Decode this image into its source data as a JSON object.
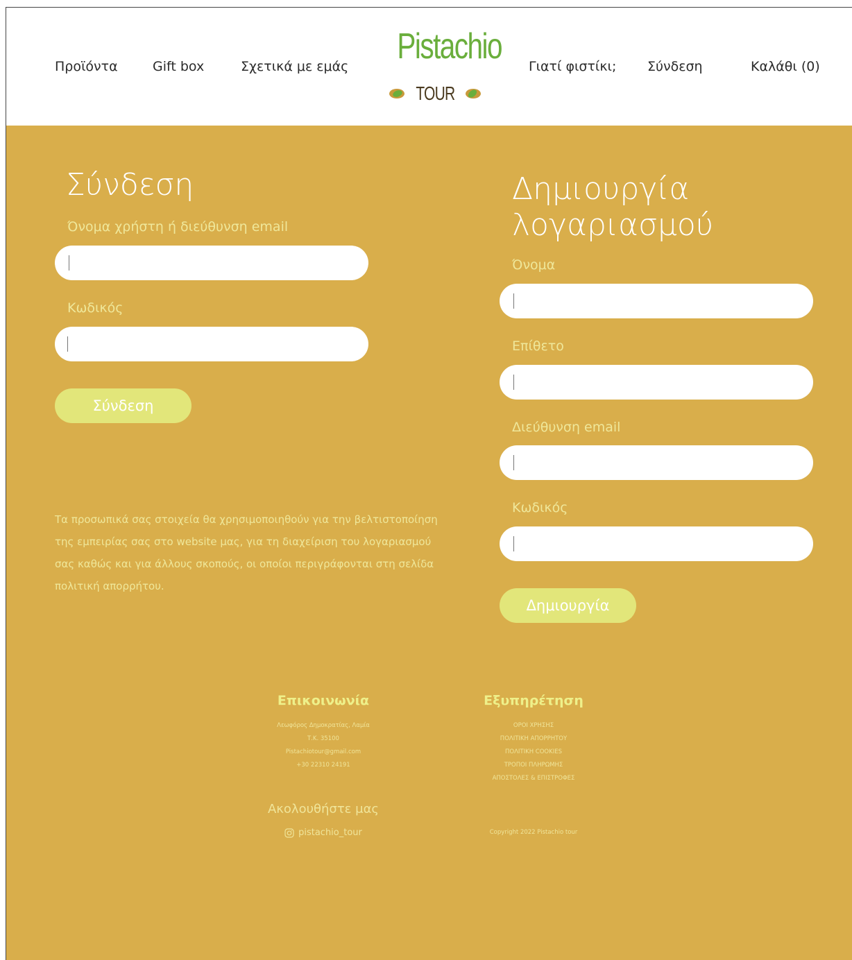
{
  "nav": {
    "left": [
      "Προϊόντα",
      "Gift box",
      "Σχετικά με εμάς"
    ],
    "right": [
      "Γιατί φιστίκι;",
      "Σύνδεση",
      "Καλάθι (0)"
    ]
  },
  "logo": {
    "word": "Pistachio",
    "sub": "TOUR",
    "colors": {
      "green": "#6aae3c",
      "brown": "#4a3a1f",
      "tan": "#c99a3b"
    }
  },
  "login": {
    "title": "Σύνδεση",
    "username_label": "Όνομα χρήστη ή διεύθυνση email",
    "password_label": "Κωδικός",
    "submit": "Σύνδεση"
  },
  "privacy": "Τα προσωπικά σας στοιχεία θα χρησιμοποιηθούν για την βελτιστοποίηση της εμπειρίας σας στο website μας, για τη διαχείριση του λογαριασμού σας καθώς και για άλλους σκοπούς, οι οποίοι περιγράφονται στη σελίδα πολιτική απορρήτου.",
  "register": {
    "title_line1": "Δημιουργία",
    "title_line2": "λογαριασμού",
    "first_name_label": "Όνομα",
    "last_name_label": "Επίθετο",
    "email_label": "Διεύθυνση email",
    "password_label": "Κωδικός",
    "submit": "Δημιουργία"
  },
  "footer": {
    "contact": {
      "title": "Επικοινωνία",
      "lines": [
        "Λεωφόρος Δημοκρατίας, Λαμία",
        "Τ.Κ. 35100",
        "Pistachiotour@gmail.com",
        "+30 22310 24191"
      ]
    },
    "service": {
      "title": "Εξυπηρέτηση",
      "links": [
        "ΟΡΟΙ ΧΡΗΣΗΣ",
        "ΠΟΛΙΤΙΚΗ ΑΠΟΡΡΗΤΟΥ",
        "ΠΟΛΙΤΙΚΗ COOKIES",
        "ΤΡΟΠΟΙ ΠΛΗΡΩΜΗΣ",
        "ΑΠΟΣΤΟΛΕΣ & ΕΠΙΣΤΡΟΦΕΣ"
      ]
    },
    "follow_title": "Ακολουθήστε μας",
    "instagram": "pistachio_tour",
    "copyright": "Copyright 2022 Pistachio tour"
  },
  "colors": {
    "background": "#d9ae4b",
    "button": "#e2e67a",
    "label": "#efe79a"
  }
}
